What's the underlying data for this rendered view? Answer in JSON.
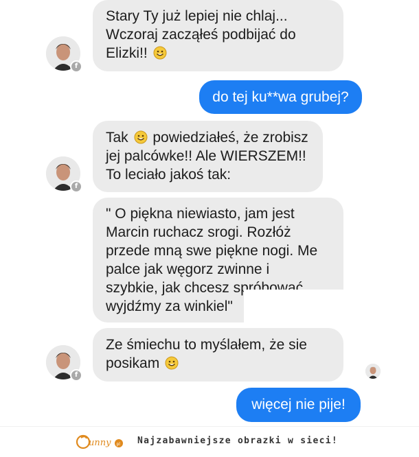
{
  "messages": [
    {
      "from": "friend",
      "lines": [
        "Stary Ty już lepiej nie chlaj...",
        "Wczoraj zacząłeś podbijać do",
        "Elizki!!"
      ],
      "emoji_after_last": true
    },
    {
      "from": "me",
      "lines": [
        "do tej ku**wa grubej?"
      ]
    },
    {
      "from": "friend",
      "lines": [
        "Tak",
        "powiedziałeś, że zrobisz",
        "jej palcówke!! Ale WIERSZEM!!",
        "To leciało jakoś tak:"
      ],
      "emoji_after_first": true
    },
    {
      "from": "friend",
      "lines": [
        "\" O piękna niewiasto, jam jest",
        "Marcin ruchacz srogi. Rozłóż",
        "przede mną swe piękne nogi. Me",
        "palce jak węgorz zwinne i",
        "szybkie, jak chcesz spróbować",
        "wyjdźmy za winkiel\""
      ]
    },
    {
      "from": "friend",
      "lines": [
        "Ze śmiechu to myślałem, że sie",
        "posikam"
      ],
      "emoji_after_last": true
    },
    {
      "from": "me",
      "lines": [
        "więcej nie pije!"
      ]
    }
  ],
  "footer": {
    "logo_text": "funny.pl",
    "tagline": "Najzabawniejsze obrazki w sieci!"
  },
  "colors": {
    "incoming_bubble": "#ebebeb",
    "outgoing_bubble": "#1d7ef3",
    "emoji": "#f5c93a"
  },
  "icons": {
    "avatar": "person-avatar",
    "badge": "facebook-badge-icon",
    "emoji": "smiling-face-emoji-icon",
    "read_receipt": "read-receipt-avatar"
  }
}
